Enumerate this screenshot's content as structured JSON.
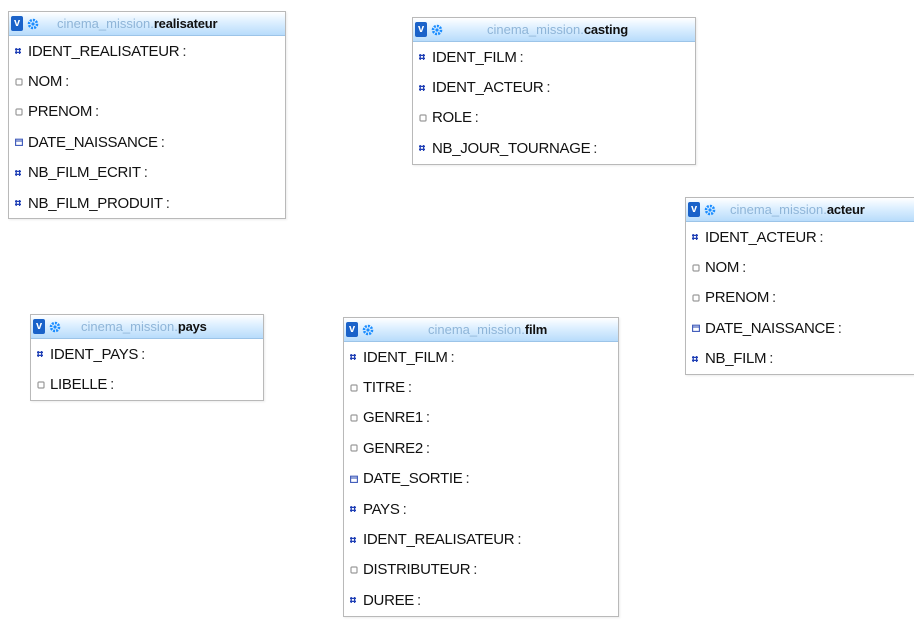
{
  "tables": [
    {
      "id": "realisateur",
      "db": "cinema_mission",
      "name": "realisateur",
      "columns": [
        {
          "name": "IDENT_REALISATEUR",
          "sep": ":",
          "icon": "numeric-type-icon"
        },
        {
          "name": "NOM",
          "sep": ":",
          "icon": "text-type-icon"
        },
        {
          "name": "PRENOM",
          "sep": ":",
          "icon": "text-type-icon"
        },
        {
          "name": "DATE_NAISSANCE",
          "sep": ":",
          "icon": "date-type-icon"
        },
        {
          "name": "NB_FILM_ECRIT",
          "sep": ":",
          "icon": "numeric-type-icon"
        },
        {
          "name": "NB_FILM_PRODUIT",
          "sep": ":",
          "icon": "numeric-type-icon"
        }
      ]
    },
    {
      "id": "casting",
      "db": "cinema_mission",
      "name": "casting",
      "columns": [
        {
          "name": "IDENT_FILM",
          "sep": ":",
          "icon": "numeric-type-icon"
        },
        {
          "name": "IDENT_ACTEUR",
          "sep": ":",
          "icon": "numeric-type-icon"
        },
        {
          "name": "ROLE",
          "sep": ":",
          "icon": "text-type-icon"
        },
        {
          "name": "NB_JOUR_TOURNAGE",
          "sep": ":",
          "icon": "numeric-type-icon"
        }
      ]
    },
    {
      "id": "acteur",
      "db": "cinema_mission",
      "name": "acteur",
      "columns": [
        {
          "name": "IDENT_ACTEUR",
          "sep": ":",
          "icon": "numeric-type-icon"
        },
        {
          "name": "NOM",
          "sep": ":",
          "icon": "text-type-icon"
        },
        {
          "name": "PRENOM",
          "sep": ":",
          "icon": "text-type-icon"
        },
        {
          "name": "DATE_NAISSANCE",
          "sep": ":",
          "icon": "date-type-icon"
        },
        {
          "name": "NB_FILM",
          "sep": ":",
          "icon": "numeric-type-icon"
        }
      ]
    },
    {
      "id": "pays",
      "db": "cinema_mission",
      "name": "pays",
      "columns": [
        {
          "name": "IDENT_PAYS",
          "sep": ":",
          "icon": "numeric-type-icon"
        },
        {
          "name": "LIBELLE",
          "sep": ":",
          "icon": "text-type-icon"
        }
      ]
    },
    {
      "id": "film",
      "db": "cinema_mission",
      "name": "film",
      "columns": [
        {
          "name": "IDENT_FILM",
          "sep": ":",
          "icon": "numeric-type-icon"
        },
        {
          "name": "TITRE",
          "sep": ":",
          "icon": "text-type-icon"
        },
        {
          "name": "GENRE1",
          "sep": ":",
          "icon": "text-type-icon"
        },
        {
          "name": "GENRE2",
          "sep": ":",
          "icon": "text-type-icon"
        },
        {
          "name": "DATE_SORTIE",
          "sep": ":",
          "icon": "date-type-icon"
        },
        {
          "name": "PAYS",
          "sep": ":",
          "icon": "numeric-type-icon"
        },
        {
          "name": "IDENT_REALISATEUR",
          "sep": ":",
          "icon": "numeric-type-icon"
        },
        {
          "name": "DISTRIBUTEUR",
          "sep": ":",
          "icon": "text-type-icon"
        },
        {
          "name": "DUREE",
          "sep": ":",
          "icon": "numeric-type-icon"
        }
      ]
    }
  ],
  "ui": {
    "toggle_glyph": "v",
    "accent": "#1a62c9",
    "header_text_color": "#8fb5d8",
    "numeric_icon_color": "#1f3fb5",
    "text_icon_color": "#9a9a9a"
  }
}
